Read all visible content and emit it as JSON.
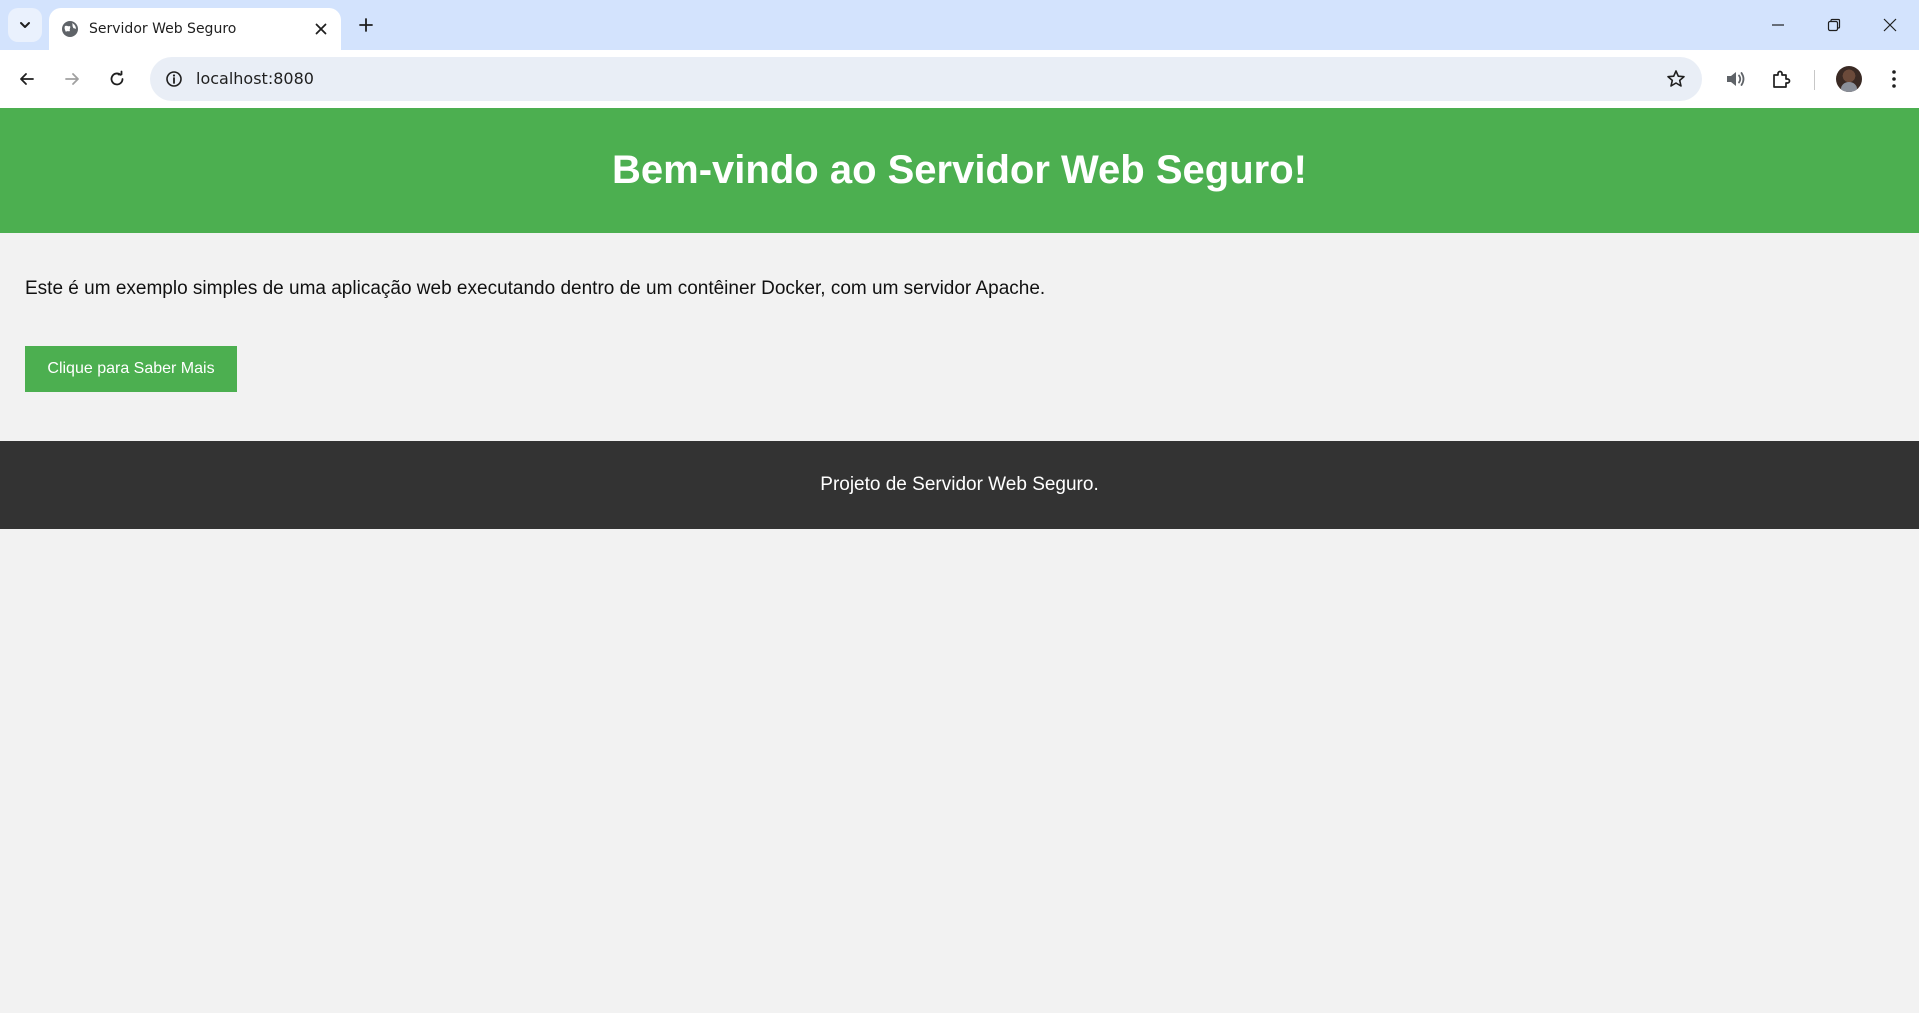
{
  "browser": {
    "tab": {
      "title": "Servidor Web Seguro",
      "favicon_icon": "globe-icon",
      "close_icon": "close-icon"
    },
    "new_tab_icon": "plus-icon",
    "tab_search_icon": "chevron-down-icon",
    "window_controls": [
      "minimize-icon",
      "restore-icon",
      "close-icon"
    ],
    "toolbar": {
      "back_icon": "arrow-left-icon",
      "forward_icon": "arrow-right-icon",
      "reload_icon": "reload-icon",
      "site_info_icon": "info-icon",
      "url": "localhost:8080",
      "bookmark_icon": "star-icon",
      "media_icon": "speaker-icon",
      "extensions_icon": "puzzle-icon",
      "menu_icon": "kebab-menu-icon"
    }
  },
  "page": {
    "header": {
      "title": "Bem-vindo ao Servidor Web Seguro!"
    },
    "intro": "Este é um exemplo simples de uma aplicação web executando dentro de um contêiner Docker, com um servidor Apache.",
    "button_label": "Clique para Saber Mais",
    "footer": "Projeto de Servidor Web Seguro."
  },
  "colors": {
    "tabstrip": "#d3e3fd",
    "accent_green": "#4caf50",
    "footer_dark": "#333333",
    "page_background": "#f2f2f2"
  }
}
